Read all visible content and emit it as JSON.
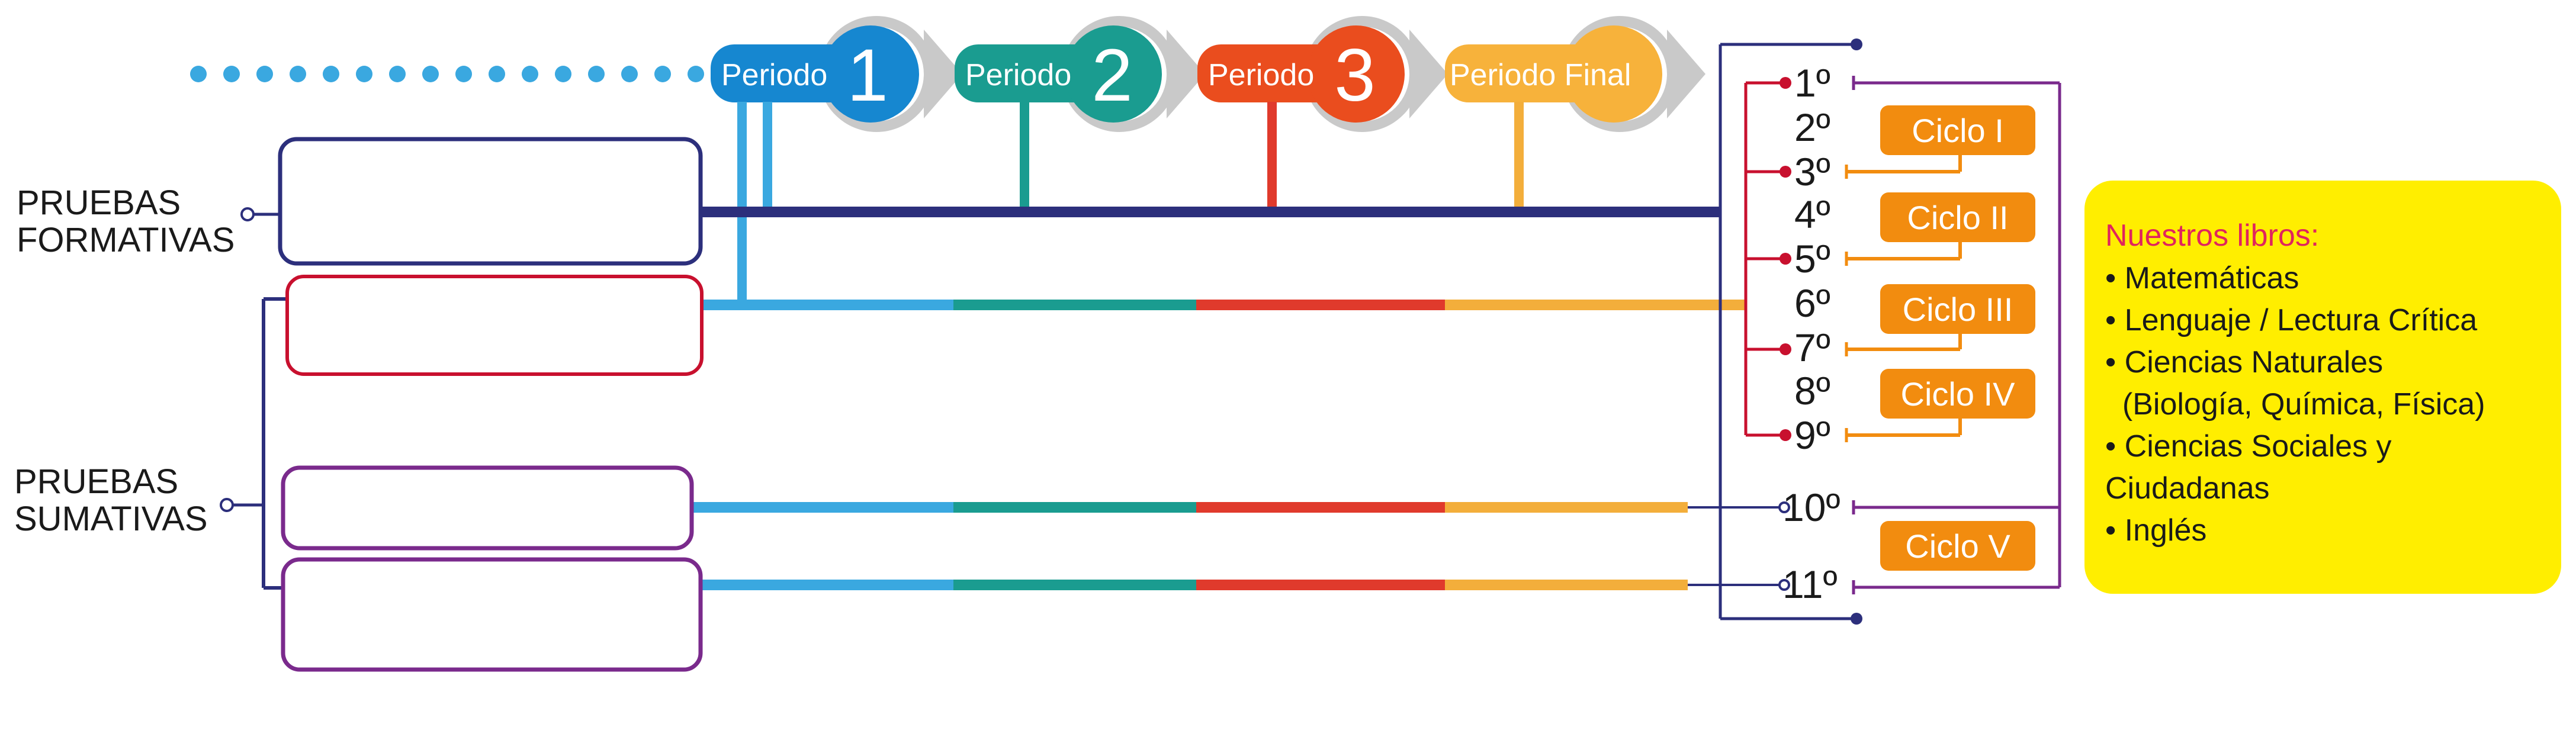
{
  "colors": {
    "navy": "#2c2f7c",
    "blue": "#3aa8e0",
    "teal": "#1a9c90",
    "red": "#e03a2c",
    "orange": "#f3ae3b",
    "ciclo_orange": "#f28c0f",
    "purple": "#7a2a8c",
    "crimson": "#c8102e",
    "book_bg": "#ffee00",
    "book_title": "#e0245e"
  },
  "periods": [
    {
      "label": "Periodo",
      "number": "1",
      "color": "#1687d0"
    },
    {
      "label": "Periodo",
      "number": "2",
      "color": "#1a9c90"
    },
    {
      "label": "Periodo",
      "number": "3",
      "color": "#ea4d1e"
    },
    {
      "label": "Periodo Final",
      "number": "",
      "color": "#f7b23b"
    }
  ],
  "left_labels": {
    "formativas": [
      "PRUEBAS",
      "FORMATIVAS"
    ],
    "sumativas": [
      "PRUEBAS",
      "SUMATIVAS"
    ]
  },
  "grades": [
    "1º",
    "2º",
    "3º",
    "4º",
    "5º",
    "6º",
    "7º",
    "8º",
    "9º",
    "10º",
    "11º"
  ],
  "ciclos": [
    "Ciclo I",
    "Ciclo II",
    "Ciclo III",
    "Ciclo IV",
    "Ciclo V"
  ],
  "books": {
    "title": "Nuestros libros:",
    "items": [
      "• Matemáticas",
      "• Lenguaje / Lectura Crítica",
      "• Ciencias Naturales",
      "  (Biología, Química, Física)",
      "• Ciencias Sociales y",
      "Ciudadanas",
      "• Inglés"
    ]
  }
}
